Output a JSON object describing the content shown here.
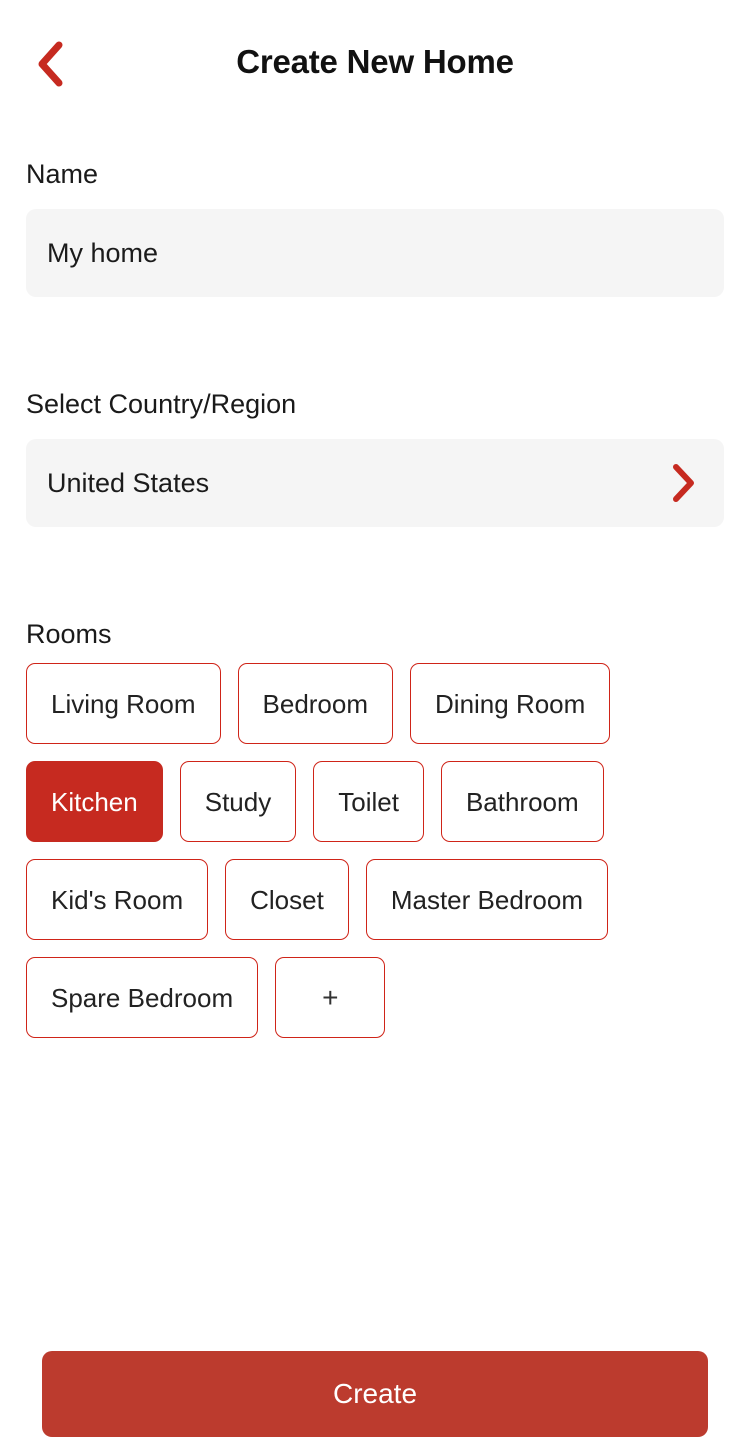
{
  "header": {
    "title": "Create New Home",
    "back_icon": "chevron-left-icon",
    "accent_color": "#cf2418"
  },
  "name_section": {
    "label": "Name",
    "value": "My home",
    "placeholder": "My home"
  },
  "country_section": {
    "label": "Select Country/Region",
    "value": "United States",
    "chevron_icon": "chevron-right-icon"
  },
  "rooms_section": {
    "label": "Rooms",
    "chips": [
      {
        "label": "Living Room",
        "selected": false
      },
      {
        "label": "Bedroom",
        "selected": false
      },
      {
        "label": "Dining Room",
        "selected": false
      },
      {
        "label": "Kitchen",
        "selected": true
      },
      {
        "label": "Study",
        "selected": false
      },
      {
        "label": "Toilet",
        "selected": false
      },
      {
        "label": "Bathroom",
        "selected": false
      },
      {
        "label": "Kid's Room",
        "selected": false
      },
      {
        "label": "Closet",
        "selected": false
      },
      {
        "label": "Master Bedroom",
        "selected": false
      },
      {
        "label": "Spare Bedroom",
        "selected": false
      },
      {
        "label": "+",
        "selected": false,
        "is_add": true
      }
    ]
  },
  "footer": {
    "create_label": "Create"
  },
  "colors": {
    "accent_red": "#cf2418",
    "selected_chip": "#c62a20",
    "primary_button": "#bc3b2e",
    "field_background": "#f5f5f5",
    "text_primary": "#1a1a1a"
  }
}
